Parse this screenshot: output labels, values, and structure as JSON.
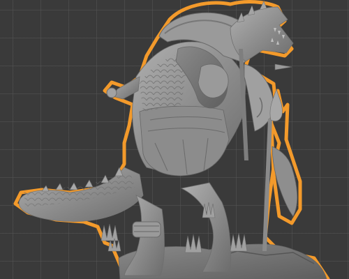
{
  "viewport": {
    "background_color": "#3a3a3a",
    "grid_color": "#555555",
    "selection_outline_color": "#f39a2b",
    "model_base_color": "#8e8e8e",
    "model_shadow_color": "#6a6a6a",
    "model_highlight_color": "#b4b4b4"
  },
  "scene": {
    "selected_object": {
      "icon": "sculpt-mesh-icon",
      "selected": true
    }
  }
}
